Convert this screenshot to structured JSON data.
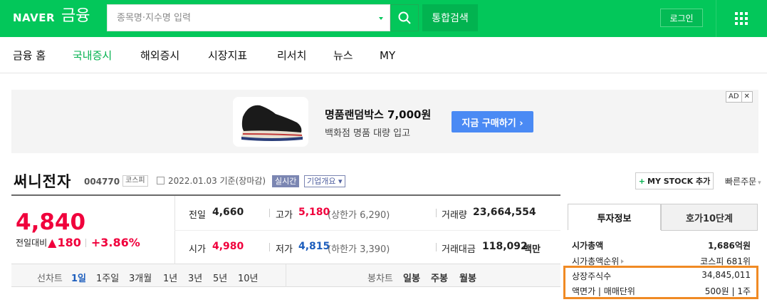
{
  "header": {
    "logo": "NAVER",
    "service": "금융",
    "search_placeholder": "종목명·지수명 입력",
    "search_button": "통합검색",
    "login": "로그인"
  },
  "nav": {
    "items": [
      "금융 홈",
      "국내증시",
      "해외증시",
      "시장지표",
      "리서치",
      "뉴스",
      "MY"
    ],
    "active_index": 1,
    "accent_color": "#03c75a"
  },
  "ad": {
    "title": "명품랜덤박스 7,000원",
    "subtitle": "백화점 명품 대량 입고",
    "cta": "지금 구매하기 ›",
    "badge": "AD",
    "close": "✕"
  },
  "stock": {
    "name": "써니전자",
    "code": "004770",
    "market": "코스피",
    "date": "2022.01.03 기준(장마감)",
    "realtime": "실시간",
    "company_info": "기업개요 ▾",
    "mystock": "MY STOCK 추가",
    "mystock_plus": "+",
    "quick_order": "빠른주문"
  },
  "quote": {
    "price": "4,840",
    "change_label": "전일대비",
    "change_arrow": "▲",
    "change_amount": "180",
    "change_pct": "+3.86%",
    "prev_close_label": "전일",
    "prev_close": "4,660",
    "high_label": "고가",
    "high": "5,180",
    "upper_limit": "(상한가 6,290)",
    "volume_label": "거래량",
    "volume": "23,664,554",
    "open_label": "시가",
    "open": "4,980",
    "low_label": "저가",
    "low": "4,815",
    "lower_limit": "(하한가 3,390)",
    "amount_label": "거래대금",
    "amount": "118,092",
    "amount_unit": "백만",
    "up_color": "#f0003c",
    "down_color": "#1d5ebd"
  },
  "chart_tabs": {
    "line_label": "선차트",
    "line_periods": [
      "1일",
      "1주일",
      "3개월",
      "1년",
      "3년",
      "5년",
      "10년"
    ],
    "candle_label": "봉차트",
    "candle_periods": [
      "일봉",
      "주봉",
      "월봉"
    ]
  },
  "invest_panel": {
    "tabs": [
      "투자정보",
      "호가10단계"
    ],
    "rows": [
      {
        "key": "시가총액",
        "value": "1,686억원"
      },
      {
        "key": "시가총액순위",
        "value": "코스피 681위"
      },
      {
        "key": "상장주식수",
        "value": "34,845,011"
      },
      {
        "key": "액면가 | 매매단위",
        "value": "500원 | 1주"
      }
    ],
    "highlight_color": "#f08a24"
  }
}
